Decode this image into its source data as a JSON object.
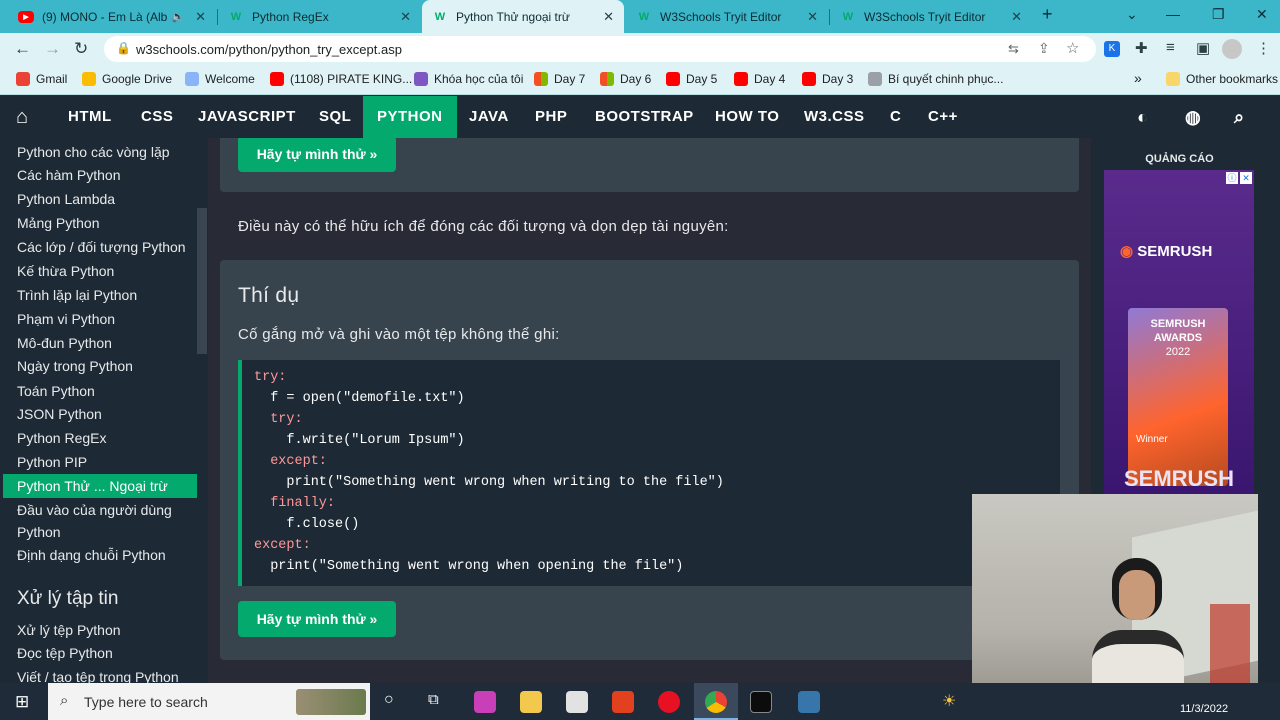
{
  "browser": {
    "tabs": [
      {
        "title": "(9) MONO - Em Là (Albu",
        "favicon": "youtube-icon",
        "active": false
      },
      {
        "title": "Python RegEx",
        "favicon": "w3schools-icon",
        "active": false
      },
      {
        "title": "Python Thử ngoại trừ",
        "favicon": "w3schools-icon",
        "active": true
      },
      {
        "title": "W3Schools Tryit Editor",
        "favicon": "w3schools-icon",
        "active": false
      },
      {
        "title": "W3Schools Tryit Editor",
        "favicon": "w3schools-icon",
        "active": false
      }
    ],
    "new_tab": "+",
    "url": "w3schools.com/python/python_try_except.asp",
    "bookmarks": [
      {
        "label": "Gmail",
        "icon": "gmail-icon",
        "color": "#ea4335"
      },
      {
        "label": "Google Drive",
        "icon": "drive-icon",
        "color": "#fbbc04"
      },
      {
        "label": "Welcome",
        "icon": "welcome-icon",
        "color": "#8ab4f8"
      },
      {
        "label": "(1108) PIRATE KING...",
        "icon": "youtube-icon",
        "color": "#ff0000"
      },
      {
        "label": "Khóa học của tôi",
        "icon": "course-icon",
        "color": "#7e57c2"
      },
      {
        "label": "Day 7",
        "icon": "microsoft-icon",
        "color": "#f25022"
      },
      {
        "label": "Day 6",
        "icon": "microsoft-icon",
        "color": "#f25022"
      },
      {
        "label": "Day 5",
        "icon": "youtube-icon",
        "color": "#ff0000"
      },
      {
        "label": "Day 4",
        "icon": "youtube-icon",
        "color": "#ff0000"
      },
      {
        "label": "Day 3",
        "icon": "youtube-icon",
        "color": "#ff0000"
      },
      {
        "label": "Bí quyết chinh phục...",
        "icon": "link-icon",
        "color": "#5f6368"
      }
    ],
    "other_bookmarks": "Other bookmarks"
  },
  "w3nav": {
    "items": [
      "HTML",
      "CSS",
      "JAVASCRIPT",
      "SQL",
      "PYTHON",
      "JAVA",
      "PHP",
      "BOOTSTRAP",
      "HOW TO",
      "W3.CSS",
      "C",
      "C++"
    ],
    "active": "PYTHON"
  },
  "sidebar": {
    "items": [
      "Python cho các vòng lặp",
      "Các hàm Python",
      "Python Lambda",
      "Mảng Python",
      "Các lớp / đối tượng Python",
      "Kế thừa Python",
      "Trình lặp lại Python",
      "Phạm vi Python",
      "Mô-đun Python",
      "Ngày trong Python",
      "Toán Python",
      "JSON Python",
      "Python RegEx",
      "Python PIP",
      "Python Thử ... Ngoại trừ",
      "Đầu vào của người dùng",
      "Python",
      "Định dạng chuỗi Python"
    ],
    "section_heading": "Xử lý tập tin",
    "section_items": [
      "Xử lý tệp Python",
      "Đọc tệp Python",
      "Viết / tạo tệp trong Python"
    ]
  },
  "main": {
    "try_button_top": "Hãy tự mình thử »",
    "intro": "Điều này có thể hữu ích để đóng các đối tượng và dọn dẹp tài nguyên:",
    "example_title": "Thí dụ",
    "example_desc": "Cố gắng mở và ghi vào một tệp không thể ghi:",
    "code_lines": [
      "try:",
      "  f = open(\"demofile.txt\")",
      "  try:",
      "    f.write(\"Lorum Ipsum\")",
      "  except:",
      "    print(\"Something went wrong when writing to the file\")",
      "  finally:",
      "    f.close()",
      "except:",
      "  print(\"Something went wrong when opening the file\")"
    ],
    "try_button_bottom": "Hãy tự mình thử »"
  },
  "ad": {
    "label": "QUẢNG CÁO",
    "brand": "SEMRUSH",
    "award_line1": "SEMRUSH",
    "award_line2": "AWARDS",
    "award_year": "2022",
    "award_winner": "Winner",
    "footer_brand": "SEMRUSH"
  },
  "taskbar": {
    "search_placeholder": "Type here to search",
    "clock_date": "11/3/2022"
  }
}
